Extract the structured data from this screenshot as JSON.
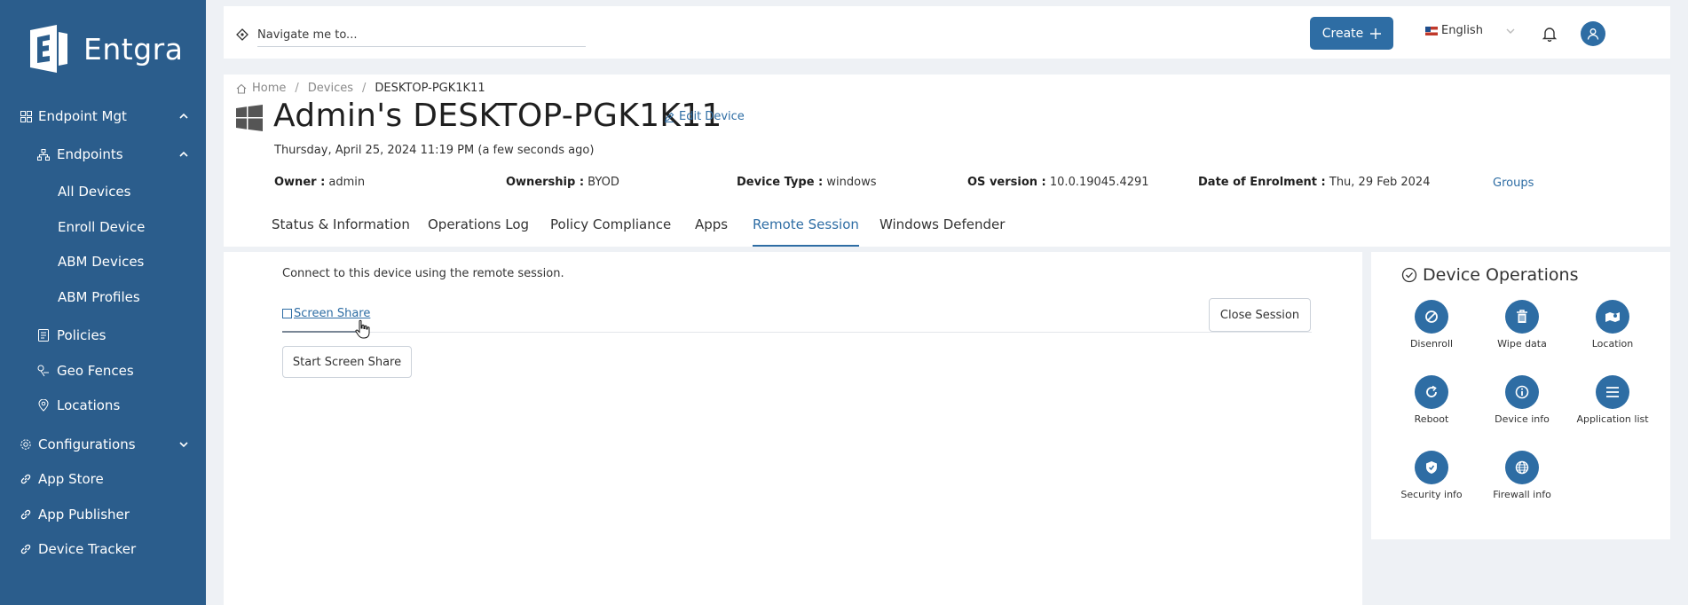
{
  "sidebar": {
    "brand": "Entgra",
    "items": [
      {
        "label": "Endpoint Mgt",
        "icon": "dashboard-icon",
        "expanded": true
      },
      {
        "label": "Endpoints",
        "icon": "sitemap-icon",
        "expanded": true
      },
      {
        "label": "All Devices"
      },
      {
        "label": "Enroll Device"
      },
      {
        "label": "ABM Devices"
      },
      {
        "label": "ABM Profiles"
      },
      {
        "label": "Policies",
        "icon": "policy-icon"
      },
      {
        "label": "Geo Fences",
        "icon": "geofence-icon"
      },
      {
        "label": "Locations",
        "icon": "location-pin-icon"
      },
      {
        "label": "Configurations",
        "icon": "gear-icon",
        "expanded": false
      },
      {
        "label": "App Store",
        "icon": "link-icon"
      },
      {
        "label": "App Publisher",
        "icon": "link-icon"
      },
      {
        "label": "Device Tracker",
        "icon": "link-icon"
      }
    ]
  },
  "topbar": {
    "search_placeholder": "Navigate me to...",
    "create_label": "Create",
    "language": "English"
  },
  "device": {
    "breadcrumb": [
      "Home",
      "Devices",
      "DESKTOP-PGK1K11"
    ],
    "title": "Admin's DESKTOP-PGK1K11",
    "edit_label": "Edit Device",
    "last_seen": "Thursday, April 25, 2024 11:19 PM (a few seconds ago)",
    "meta": [
      {
        "key": "Owner :",
        "value": "admin"
      },
      {
        "key": "Ownership :",
        "value": "BYOD"
      },
      {
        "key": "Device Type :",
        "value": "windows"
      },
      {
        "key": "OS version :",
        "value": "10.0.19045.4291"
      },
      {
        "key": "Date of Enrolment :",
        "value": "Thu, 29 Feb 2024"
      }
    ],
    "groups_label": "Groups",
    "tabs": [
      "Status & Information",
      "Operations Log",
      "Policy Compliance",
      "Apps",
      "Remote Session",
      "Windows Defender"
    ],
    "active_tab": "Remote Session"
  },
  "remote_session": {
    "intro": "Connect to this device using the remote session.",
    "tab_label": "Screen Share",
    "close_label": "Close Session",
    "start_label": "Start Screen Share"
  },
  "operations": {
    "title": "Device Operations",
    "items": [
      {
        "label": "Disenroll",
        "icon": "ban-icon"
      },
      {
        "label": "Wipe data",
        "icon": "trash-icon"
      },
      {
        "label": "Location",
        "icon": "map-icon"
      },
      {
        "label": "Reboot",
        "icon": "reboot-icon"
      },
      {
        "label": "Device info",
        "icon": "info-icon"
      },
      {
        "label": "Application list",
        "icon": "list-icon"
      },
      {
        "label": "Security info",
        "icon": "shield-icon"
      },
      {
        "label": "Firewall info",
        "icon": "globe-icon"
      }
    ]
  },
  "colors": {
    "sidebar": "#2b5d8c",
    "accent": "#2e6da4",
    "background": "#eef1f5"
  }
}
